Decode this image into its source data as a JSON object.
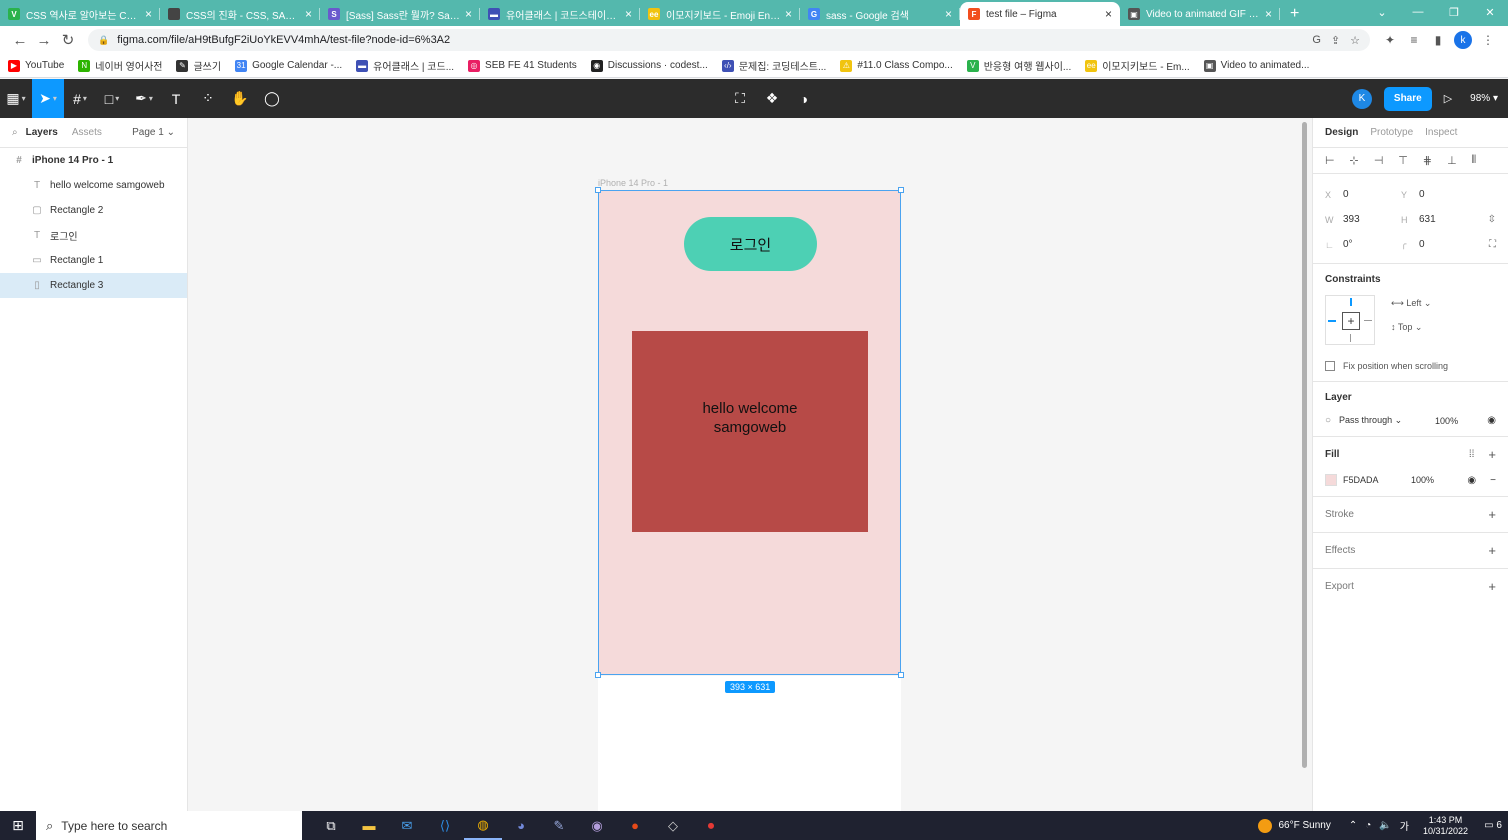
{
  "browser": {
    "tabs": [
      {
        "title": "CSS 역사로 알아보는 CSS...",
        "color": "#2bb24c",
        "glyph": "V"
      },
      {
        "title": "CSS의 진화 - CSS, SASS, B...",
        "color": "#444444",
        "glyph": ""
      },
      {
        "title": "[Sass] Sass란 뭘까? Sass의...",
        "color": "#6a5acd",
        "glyph": "S"
      },
      {
        "title": "유어클래스 | 코드스테이츠...",
        "color": "#3f51b5",
        "glyph": "▬"
      },
      {
        "title": "이모지키보드 - Emoji Engi...",
        "color": "#f1c40f",
        "glyph": "ee"
      },
      {
        "title": "sass - Google 검색",
        "color": "#4285f4",
        "glyph": "G"
      },
      {
        "title": "test file – Figma",
        "color": "#f24e1e",
        "glyph": "F"
      },
      {
        "title": "Video to animated GIF con...",
        "color": "#555555",
        "glyph": "▣"
      }
    ],
    "active_tab": 6,
    "url": "figma.com/file/aH9tBufgF2iUoYkEVV4mhA/test-file?node-id=6%3A2",
    "profile_initial": "k",
    "bookmarks": [
      {
        "label": "YouTube",
        "color": "#ff0000",
        "glyph": "▶"
      },
      {
        "label": "네이버 영어사전",
        "color": "#2db400",
        "glyph": "N"
      },
      {
        "label": "글쓰기",
        "color": "#333333",
        "glyph": "✎"
      },
      {
        "label": "Google Calendar -...",
        "color": "#4285f4",
        "glyph": "31"
      },
      {
        "label": "유어클래스 | 코드...",
        "color": "#3f51b5",
        "glyph": "▬"
      },
      {
        "label": "SEB FE 41 Students",
        "color": "#e91e63",
        "glyph": "◎"
      },
      {
        "label": "Discussions · codest...",
        "color": "#222222",
        "glyph": "◉"
      },
      {
        "label": "문제집: 코딩테스트...",
        "color": "#3f51b5",
        "glyph": "‹/›"
      },
      {
        "label": "#11.0 Class Compo...",
        "color": "#f1c40f",
        "glyph": "⚠"
      },
      {
        "label": "반응형 여행 웹사이...",
        "color": "#2bb24c",
        "glyph": "V"
      },
      {
        "label": "이모지키보드 - Em...",
        "color": "#f1c40f",
        "glyph": "ee"
      },
      {
        "label": "Video to animated...",
        "color": "#555555",
        "glyph": "▣"
      }
    ]
  },
  "figma": {
    "toolbar": {
      "share_label": "Share",
      "zoom": "98%",
      "avatar_initial": "K"
    },
    "left_panel": {
      "tabs": [
        "Layers",
        "Assets"
      ],
      "page": "Page 1",
      "layers": [
        {
          "name": "iPhone 14 Pro - 1",
          "icon": "#",
          "level": "root"
        },
        {
          "name": "hello welcome samgoweb",
          "icon": "T",
          "level": "child"
        },
        {
          "name": "Rectangle 2",
          "icon": "▢",
          "level": "child"
        },
        {
          "name": "로그인",
          "icon": "T",
          "level": "child"
        },
        {
          "name": "Rectangle 1",
          "icon": "▭",
          "level": "child"
        },
        {
          "name": "Rectangle 3",
          "icon": "▯",
          "level": "child",
          "selected": true
        }
      ]
    },
    "canvas": {
      "frame_label": "iPhone 14 Pro - 1",
      "login_text": "로그인",
      "hello_text": "hello welcome samgoweb",
      "size_badge": "393 × 631",
      "frame_fill": "#F5DADA",
      "button_fill": "#4DD0B4",
      "rect_fill": "#B74A47"
    },
    "right_panel": {
      "tabs": [
        "Design",
        "Prototype",
        "Inspect"
      ],
      "x": "0",
      "y": "0",
      "w": "393",
      "h": "631",
      "rotation": "0°",
      "radius": "0",
      "constraints_title": "Constraints",
      "constraint_h": "Left",
      "constraint_v": "Top",
      "fix_position": "Fix position when scrolling",
      "layer_title": "Layer",
      "blend": "Pass through",
      "layer_opacity": "100%",
      "fill_title": "Fill",
      "fill_hex": "F5DADA",
      "fill_opacity": "100%",
      "stroke_title": "Stroke",
      "effects_title": "Effects",
      "export_title": "Export"
    }
  },
  "taskbar": {
    "search_placeholder": "Type here to search",
    "weather": "66°F  Sunny",
    "time": "1:43 PM",
    "date": "10/31/2022",
    "notifications": "6",
    "lang": "가"
  }
}
